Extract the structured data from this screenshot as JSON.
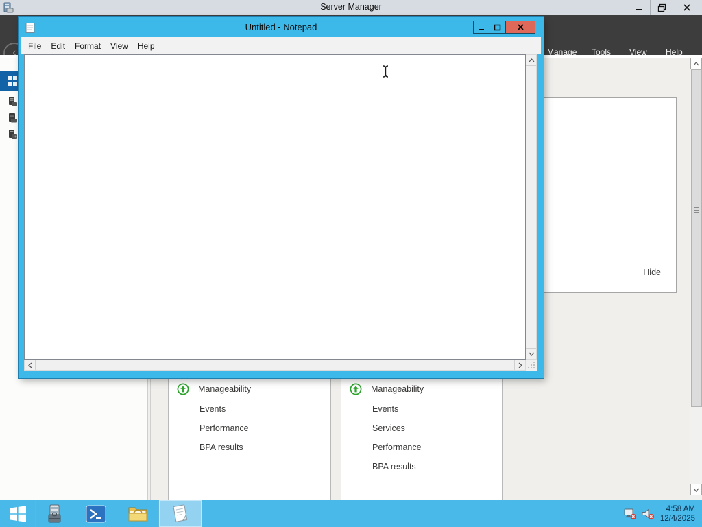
{
  "server_manager_window": {
    "title": "Server Manager",
    "menu": [
      "Manage",
      "Tools",
      "View",
      "Help"
    ],
    "details_panel": {
      "hide_label": "Hide"
    },
    "tiles": [
      {
        "header": "Manageability",
        "links": [
          "Events",
          "Performance",
          "BPA results"
        ]
      },
      {
        "header": "Manageability",
        "links": [
          "Events",
          "Services",
          "Performance",
          "BPA results"
        ]
      }
    ]
  },
  "notepad_window": {
    "title": "Untitled - Notepad",
    "menu": [
      "File",
      "Edit",
      "Format",
      "View",
      "Help"
    ],
    "text_value": ""
  },
  "taskbar": {
    "clock": {
      "time": "4:58 AM",
      "date": "12/4/2025"
    }
  },
  "icons": {
    "server-manager-app-icon": "server-with-toolbox",
    "back-icon": "left-arrow-circle",
    "dashboard-icon": "white-grid",
    "local-server-icon": "server",
    "all-servers-icon": "server-stack",
    "file-storage-icon": "server-tools",
    "status-up-icon": "green-circle-up-arrow",
    "notepad-icon": "notepad-page",
    "minimize-icon": "dash",
    "restore-icon": "overlapping-squares",
    "maximize-icon": "square",
    "close-icon": "x",
    "start-icon": "windows-flag",
    "powershell-icon": "prompt-arrow",
    "explorer-icon": "folder",
    "network-error-icon": "display-red-x",
    "audio-error-icon": "speaker-red-x",
    "ibeam-cursor": "text-cursor"
  },
  "colors": {
    "notepad_accent_blue": "#3cb9e9",
    "taskbar_blue": "#49b9e9",
    "nav_selected_blue": "#1262a8",
    "close_button_red": "#de695b",
    "status_green": "#2da32d",
    "dark_band": "#3d3d3d"
  }
}
